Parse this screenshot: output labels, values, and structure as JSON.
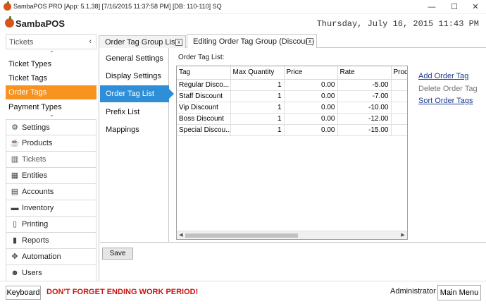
{
  "window": {
    "title": "SambaPOS PRO [App: 5.1.38] [7/16/2015 11:37:58 PM] [DB: 110-110] SQ",
    "minimize_icon": "—",
    "maximize_icon": "☐",
    "close_icon": "✕"
  },
  "header": {
    "logo": "SambaPOS",
    "datetime": "Thursday, July 16, 2015 11:43 PM"
  },
  "sidebar": {
    "section_title": "Tickets",
    "collapse_icon": "‹",
    "scroll_up": "⌃",
    "scroll_down": "⌄",
    "sub_items": [
      {
        "label": "Ticket Types",
        "active": false
      },
      {
        "label": "Ticket Tags",
        "active": false
      },
      {
        "label": "Order Tags",
        "active": true
      },
      {
        "label": "Payment Types",
        "active": false
      }
    ],
    "main_items": [
      {
        "label": "Settings",
        "icon": "gear-icon",
        "glyph": "⚙"
      },
      {
        "label": "Products",
        "icon": "coffee-cup-icon",
        "glyph": "☕"
      },
      {
        "label": "Tickets",
        "icon": "books-icon",
        "glyph": "▥"
      },
      {
        "label": "Entities",
        "icon": "grid-table-icon",
        "glyph": "▦"
      },
      {
        "label": "Accounts",
        "icon": "calculator-icon",
        "glyph": "▤"
      },
      {
        "label": "Inventory",
        "icon": "truck-icon",
        "glyph": "▬"
      },
      {
        "label": "Printing",
        "icon": "document-icon",
        "glyph": "▯"
      },
      {
        "label": "Reports",
        "icon": "bar-chart-icon",
        "glyph": "▮"
      },
      {
        "label": "Automation",
        "icon": "puzzle-icon",
        "glyph": "✥"
      },
      {
        "label": "Users",
        "icon": "user-icon",
        "glyph": "☻"
      }
    ]
  },
  "tabs": [
    {
      "label": "Order Tag Group List",
      "close": "x",
      "active": false
    },
    {
      "label": "Editing Order Tag Group (Discount)",
      "close": "x",
      "active": true
    }
  ],
  "settings_nav": [
    {
      "label": "General Settings",
      "active": false
    },
    {
      "label": "Display Settings",
      "active": false
    },
    {
      "label": "Order Tag List",
      "active": true
    },
    {
      "label": "Prefix List",
      "active": false
    },
    {
      "label": "Mappings",
      "active": false
    }
  ],
  "order_tag_list": {
    "label": "Order Tag List:",
    "columns": [
      "Tag",
      "Max Quantity",
      "Price",
      "Rate",
      "Prod"
    ],
    "rows": [
      [
        "Regular Disco...",
        "1",
        "0.00",
        "-5.00",
        ""
      ],
      [
        "Staff Discount",
        "1",
        "0.00",
        "-7.00",
        ""
      ],
      [
        "Vip Discount",
        "1",
        "0.00",
        "-10.00",
        ""
      ],
      [
        "Boss Discount",
        "1",
        "0.00",
        "-12.00",
        ""
      ],
      [
        "Special Discou...",
        "1",
        "0.00",
        "-15.00",
        ""
      ]
    ],
    "scroll_left": "◀",
    "scroll_right": "▶"
  },
  "actions": {
    "add": "Add Order Tag",
    "delete": "Delete Order Tag",
    "sort": "Sort Order Tags"
  },
  "save_label": "Save",
  "bottom": {
    "keyboard": "Keyboard",
    "warning": "DON'T FORGET ENDING WORK PERIOD!",
    "user": "Administrator",
    "main_menu": "Main Menu"
  },
  "colors": {
    "active_sidebar": "#f7931e",
    "active_nav": "#2e8fd8",
    "warning": "#cc1111",
    "link": "#1a3a8c"
  }
}
